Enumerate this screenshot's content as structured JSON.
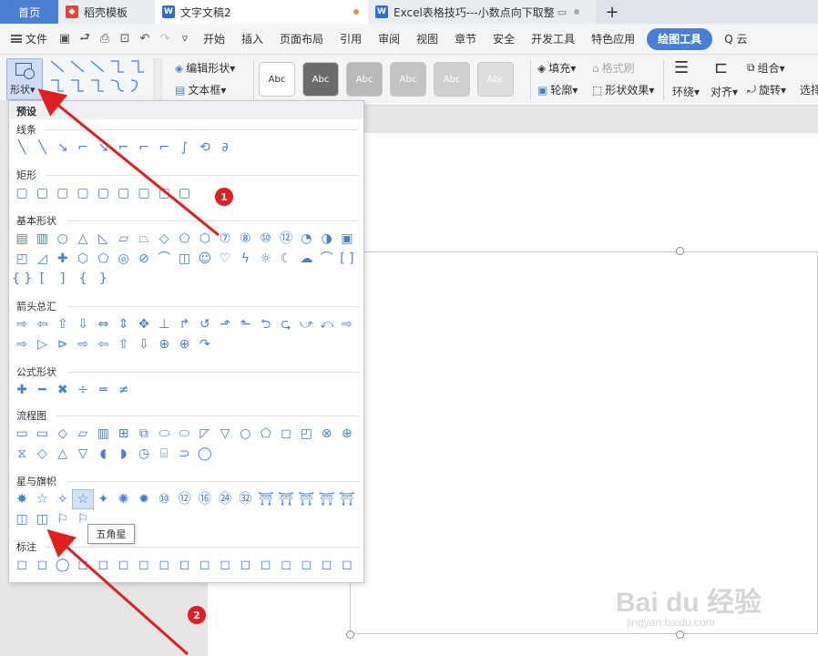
{
  "tabs": [
    {
      "label": "首页"
    },
    {
      "label": "稻壳模板"
    },
    {
      "label": "文字文稿2"
    },
    {
      "label": "Excel表格技巧---小数点向下取整"
    }
  ],
  "menu": {
    "file": "文件",
    "items": [
      "开始",
      "插入",
      "页面布局",
      "引用",
      "审阅",
      "视图",
      "章节",
      "安全",
      "开发工具",
      "特色应用"
    ],
    "active": "绘图工具",
    "search": "Q 云"
  },
  "ribbon": {
    "shape_button": "形状",
    "edit_shape": "编辑形状",
    "text_box": "文本框",
    "style_samples": [
      "Abc",
      "Abc",
      "Abc",
      "Abc",
      "Abc",
      "Abc"
    ],
    "fill": "填充",
    "format_brush": "格式刷",
    "outline": "轮廓",
    "shape_effect": "形状效果",
    "wrap": "环绕",
    "align": "对齐",
    "group": "组合",
    "rotate": "旋转",
    "select": "选择"
  },
  "panel": {
    "header": "预设",
    "categories": [
      {
        "name": "线条",
        "shapes": [
          "╲",
          "╲",
          "↘",
          "⌐",
          "↘",
          "⌐",
          "⌐",
          "⌐",
          "∫",
          "⟲",
          "∂"
        ]
      },
      {
        "name": "矩形",
        "shapes": [
          "▢",
          "▢",
          "▢",
          "▢",
          "▢",
          "▢",
          "▢",
          "▢",
          "▢"
        ]
      },
      {
        "name": "基本形状",
        "shapes": [
          "▤",
          "▥",
          "○",
          "△",
          "◺",
          "▱",
          "⏢",
          "◇",
          "⬠",
          "⬡",
          "⑦",
          "⑧",
          "⑩",
          "⑫",
          "◔",
          "◑",
          "▣",
          "◰",
          "◿",
          "✚",
          "⬡",
          "⬠",
          "◎",
          "⊘",
          "⌒",
          "◫",
          "☺",
          "♡",
          "ϟ",
          "☼",
          "☾",
          "☁",
          "⌒",
          "[ ]",
          "{ }",
          "[",
          "]",
          "{",
          "}"
        ]
      },
      {
        "name": "箭头总汇",
        "shapes": [
          "⇨",
          "⇦",
          "⇧",
          "⇩",
          "⇔",
          "⇕",
          "✥",
          "⊥",
          "↱",
          "↺",
          "⬏",
          "⬑",
          "⮌",
          "⮎",
          "⤻",
          "⤺",
          "⇨",
          "⇨",
          "▷",
          "⊳",
          "⇨",
          "⇦",
          "⇧",
          "⇩",
          "⊕",
          "⊕",
          "↷"
        ]
      },
      {
        "name": "公式形状",
        "shapes": [
          "✚",
          "━",
          "✖",
          "÷",
          "═",
          "≠"
        ]
      },
      {
        "name": "流程图",
        "shapes": [
          "▭",
          "▭",
          "◇",
          "▱",
          "▥",
          "⊞",
          "⧉",
          "⬭",
          "⬭",
          "◸",
          "▽",
          "○",
          "⬠",
          "◻",
          "◰",
          "⊗",
          "⊕",
          "⧖",
          "◇",
          "△",
          "▽",
          "◖",
          "◗",
          "◷",
          "⌸",
          "⊃",
          "◯"
        ]
      },
      {
        "name": "星与旗帜",
        "shapes": [
          "✸",
          "☆",
          "✧",
          "☆",
          "✦",
          "✺",
          "✹",
          "⑩",
          "⑫",
          "⑯",
          "㉔",
          "㉜",
          "⛩",
          "⛩",
          "⛩",
          "⛩",
          "⛩",
          "◫",
          "◫",
          "⚐",
          "⚐"
        ]
      },
      {
        "name": "标注",
        "shapes": [
          "◻",
          "◻",
          "◯",
          "◻",
          "◻",
          "◻",
          "◻",
          "◻",
          "◻",
          "◻",
          "◻",
          "◻",
          "◻",
          "◻",
          "◻",
          "◻",
          "◻"
        ]
      }
    ],
    "tooltip": "五角星"
  },
  "annotations": {
    "badge1": "1",
    "badge2": "2"
  },
  "watermark": {
    "main": "Bai du 经验",
    "sub": "jingyan.baidu.com"
  },
  "colors": {
    "accent": "#4a7fd4",
    "shape_blue": "#4a80d4",
    "arrow_red": "#e02020"
  }
}
